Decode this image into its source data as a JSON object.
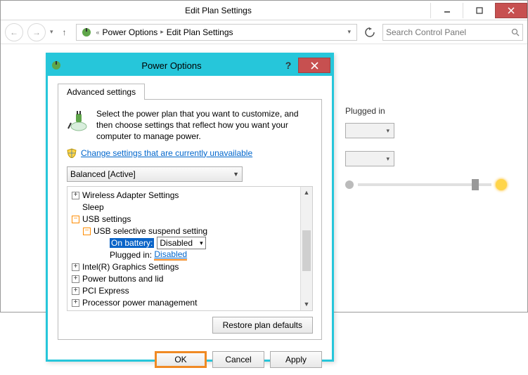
{
  "parent_window": {
    "title": "Edit Plan Settings",
    "breadcrumb": [
      "Power Options",
      "Edit Plan Settings"
    ],
    "search_placeholder": "Search Control Panel"
  },
  "background": {
    "column_header": "Plugged in"
  },
  "dialog": {
    "title": "Power Options",
    "tab": "Advanced settings",
    "intro": "Select the power plan that you want to customize, and then choose settings that reflect how you want your computer to manage power.",
    "uac_link": "Change settings that are currently unavailable",
    "plan_selected": "Balanced [Active]",
    "tree": {
      "items": [
        {
          "label": "Wireless Adapter Settings",
          "toggle": "plus"
        },
        {
          "label": "Sleep",
          "toggle": "none"
        },
        {
          "label": "USB settings",
          "toggle": "minus"
        },
        {
          "label": "USB selective suspend setting",
          "toggle": "minus",
          "indent": 1
        },
        {
          "label_prefix": "On battery:",
          "value": "Disabled",
          "mode": "combo",
          "indent": 2,
          "highlight": true
        },
        {
          "label_prefix": "Plugged in:",
          "value": "Disabled",
          "mode": "link",
          "indent": 2
        },
        {
          "label": "Intel(R) Graphics Settings",
          "toggle": "plus"
        },
        {
          "label": "Power buttons and lid",
          "toggle": "plus"
        },
        {
          "label": "PCI Express",
          "toggle": "plus"
        },
        {
          "label": "Processor power management",
          "toggle": "plus"
        }
      ]
    },
    "restore_label": "Restore plan defaults",
    "buttons": {
      "ok": "OK",
      "cancel": "Cancel",
      "apply": "Apply"
    }
  }
}
